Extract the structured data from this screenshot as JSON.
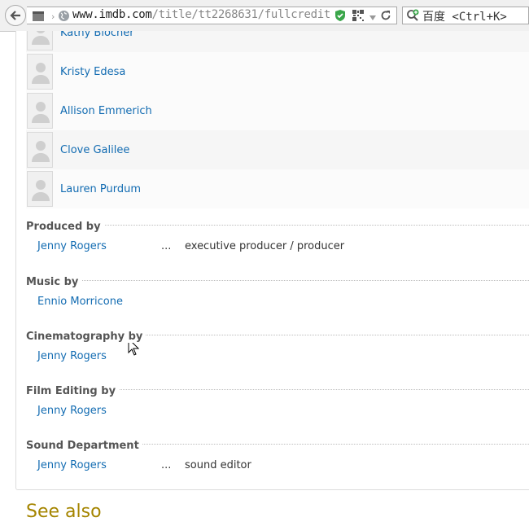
{
  "browser": {
    "url_domain": "www.imdb.com",
    "url_path": "/title/tt2268631/fullcredit",
    "search_text": "百度 <Ctrl+K>"
  },
  "cast": [
    {
      "name": "Kathy Blocher"
    },
    {
      "name": "Kristy Edesa"
    },
    {
      "name": "Allison Emmerich"
    },
    {
      "name": "Clove Galilee"
    },
    {
      "name": "Lauren Purdum"
    }
  ],
  "sections": [
    {
      "title": "Produced by",
      "credits": [
        {
          "name": "Jenny Rogers",
          "ellipsis": "...",
          "role": "executive producer / producer"
        }
      ]
    },
    {
      "title": "Music by",
      "credits": [
        {
          "name": "Ennio Morricone"
        }
      ]
    },
    {
      "title": "Cinematography by",
      "credits": [
        {
          "name": "Jenny Rogers"
        }
      ]
    },
    {
      "title": "Film Editing by",
      "credits": [
        {
          "name": "Jenny Rogers"
        }
      ]
    },
    {
      "title": "Sound Department",
      "credits": [
        {
          "name": "Jenny Rogers",
          "ellipsis": "...",
          "role": "sound editor"
        }
      ]
    }
  ],
  "see_also": {
    "title": "See also"
  },
  "colors": {
    "link": "#136cb2",
    "see_also": "#a58500",
    "section_title": "#555555"
  }
}
